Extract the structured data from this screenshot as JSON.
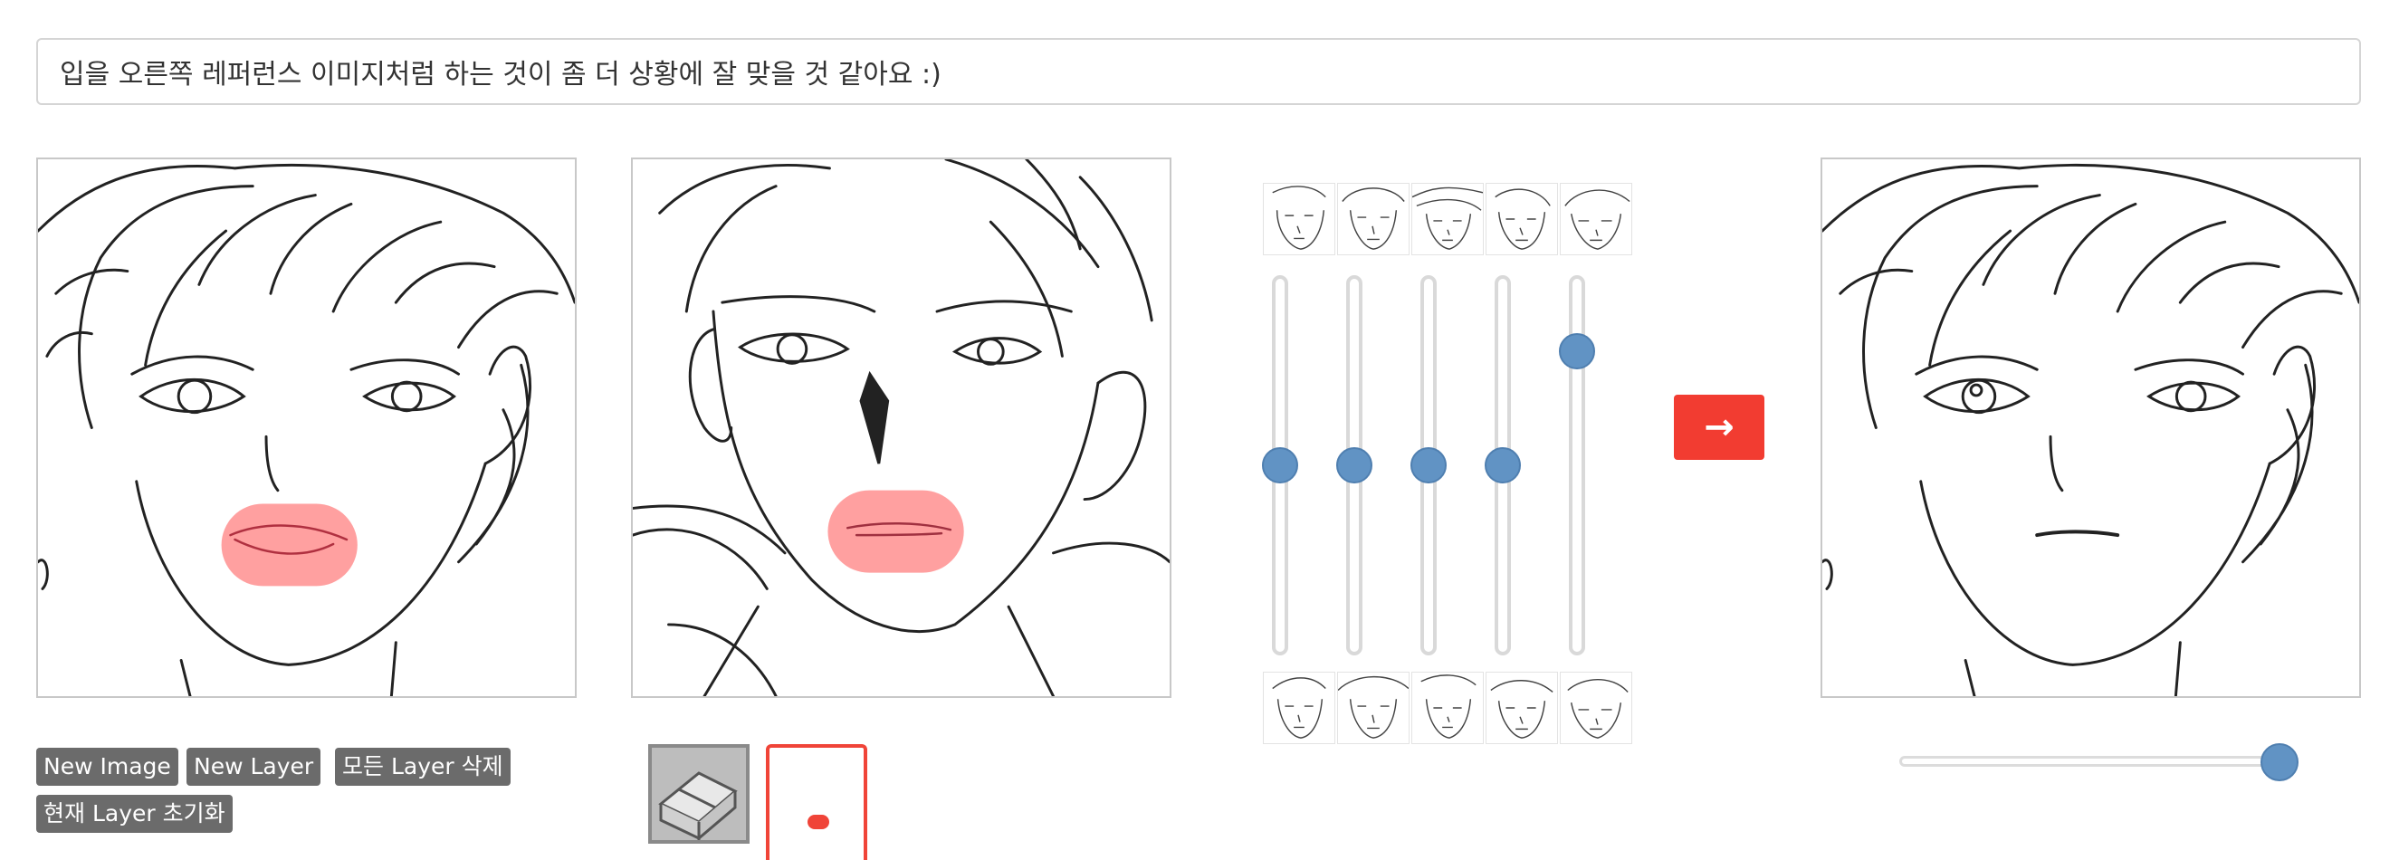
{
  "comment": {
    "value": "입을 오른쪽 레퍼런스 이미지처럼 하는 것이 좀 더 상황에 잘 맞을 것 같아요 :)"
  },
  "buttons": {
    "new_image": "New Image",
    "new_layer": "New Layer",
    "delete_all_layers": "모든 Layer 삭제",
    "reset_layer": "현재 Layer 초기화"
  },
  "tools": {
    "eraser": "eraser-icon",
    "brush": "brush-icon"
  },
  "run_button": {
    "label": "→"
  },
  "colors": {
    "accent_red": "#f23c31",
    "slider_blue": "#6193c4",
    "mask_red": "#ff8f8f",
    "button_gray": "#6b6b6b"
  },
  "sliders": {
    "style_mix_levels": [
      0.5,
      0.5,
      0.5,
      0.5,
      0.8
    ],
    "output_blend_level": 1.0
  }
}
